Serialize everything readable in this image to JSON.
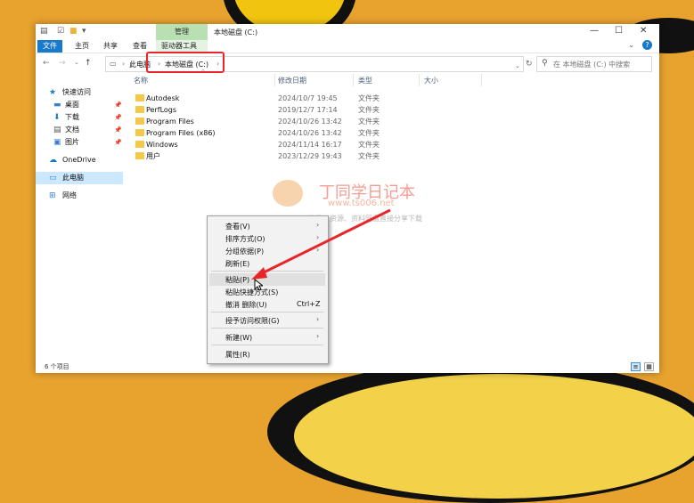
{
  "titlebar": {
    "context_tab": "管理",
    "window_title": "本地磁盘 (C:)",
    "minimize": "—",
    "maximize": "☐",
    "close": "✕"
  },
  "ribbon": {
    "tabs": [
      "文件",
      "主页",
      "共享",
      "查看",
      "驱动器工具"
    ]
  },
  "address": {
    "crumbs": [
      "此电脑",
      "本地磁盘 (C:)"
    ],
    "search_placeholder": "在 本地磁盘 (C:) 中搜索"
  },
  "nav_pane": {
    "items": [
      {
        "label": "快速访问",
        "icon": "star-icon"
      },
      {
        "label": "桌面",
        "icon": "desktop-icon",
        "pinned": true
      },
      {
        "label": "下载",
        "icon": "download-icon",
        "pinned": true
      },
      {
        "label": "文档",
        "icon": "document-icon",
        "pinned": true
      },
      {
        "label": "图片",
        "icon": "picture-icon",
        "pinned": true
      },
      {
        "label": "OneDrive",
        "icon": "cloud-icon"
      },
      {
        "label": "此电脑",
        "icon": "computer-icon"
      },
      {
        "label": "网络",
        "icon": "network-icon"
      }
    ]
  },
  "columns": {
    "name": "名称",
    "date": "修改日期",
    "type": "类型",
    "size": "大小"
  },
  "files": [
    {
      "name": "Autodesk",
      "date": "2024/10/7 19:45",
      "type": "文件夹"
    },
    {
      "name": "PerfLogs",
      "date": "2019/12/7 17:14",
      "type": "文件夹"
    },
    {
      "name": "Program Files",
      "date": "2024/10/26 13:42",
      "type": "文件夹"
    },
    {
      "name": "Program Files (x86)",
      "date": "2024/10/26 13:42",
      "type": "文件夹"
    },
    {
      "name": "Windows",
      "date": "2024/11/14 16:17",
      "type": "文件夹"
    },
    {
      "name": "用户",
      "date": "2023/12/29 19:43",
      "type": "文件夹"
    }
  ],
  "status": {
    "count": "6 个项目"
  },
  "context_menu": {
    "items": [
      {
        "label": "查看(V)",
        "submenu": true
      },
      {
        "label": "排序方式(O)",
        "submenu": true
      },
      {
        "label": "分组依据(P)",
        "submenu": true
      },
      {
        "label": "刷新(E)"
      },
      {
        "label": "粘贴(P)"
      },
      {
        "label": "粘贴快捷方式(S)"
      },
      {
        "label": "撤消 删除(U)",
        "shortcut": "Ctrl+Z"
      },
      {
        "label": "授予访问权限(G)",
        "submenu": true
      },
      {
        "label": "新建(W)",
        "submenu": true
      },
      {
        "label": "属性(R)"
      }
    ]
  },
  "watermark": {
    "title": "丁同学日记本",
    "url": "www.ts006.net",
    "tagline": "软件、资源、资料网盘直接分享下载"
  },
  "colors": {
    "background": "#e8a22e",
    "accent": "#1979ca",
    "highlight_box": "#e8262a",
    "selection": "#cce8ff"
  }
}
